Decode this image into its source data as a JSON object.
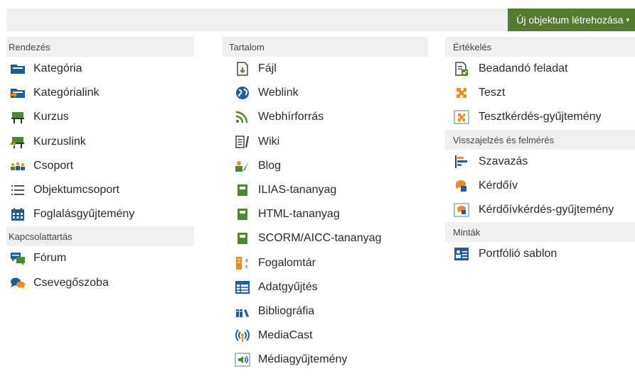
{
  "toolbar": {
    "create_label": "Új objektum létrehozása",
    "caret": "▾"
  },
  "columns": [
    {
      "groups": [
        {
          "title": "Rendezés",
          "items": [
            {
              "label": "Kategória",
              "icon": "category-folder-icon"
            },
            {
              "label": "Kategórialink",
              "icon": "category-link-icon"
            },
            {
              "label": "Kurzus",
              "icon": "course-icon"
            },
            {
              "label": "Kurzuslink",
              "icon": "course-link-icon"
            },
            {
              "label": "Csoport",
              "icon": "group-icon"
            },
            {
              "label": "Objektumcsoport",
              "icon": "object-group-list-icon"
            },
            {
              "label": "Foglalásgyűjtemény",
              "icon": "booking-calendar-icon"
            }
          ]
        },
        {
          "title": "Kapcsolattartás",
          "items": [
            {
              "label": "Fórum",
              "icon": "forum-icon"
            },
            {
              "label": "Csevegőszoba",
              "icon": "chat-icon"
            }
          ]
        }
      ]
    },
    {
      "groups": [
        {
          "title": "Tartalom",
          "items": [
            {
              "label": "Fájl",
              "icon": "file-download-icon"
            },
            {
              "label": "Weblink",
              "icon": "weblink-globe-icon"
            },
            {
              "label": "Webhírforrás",
              "icon": "rss-feed-icon"
            },
            {
              "label": "Wiki",
              "icon": "wiki-icon"
            },
            {
              "label": "Blog",
              "icon": "blog-icon"
            },
            {
              "label": "ILIAS-tananyag",
              "icon": "learning-module-icon"
            },
            {
              "label": "HTML-tananyag",
              "icon": "html-module-icon"
            },
            {
              "label": "SCORM/AICC-tananyag",
              "icon": "scorm-module-icon"
            },
            {
              "label": "Fogalomtár",
              "icon": "glossary-icon"
            },
            {
              "label": "Adatgyűjtés",
              "icon": "data-collection-table-icon"
            },
            {
              "label": "Bibliográfia",
              "icon": "bibliography-books-icon"
            },
            {
              "label": "MediaCast",
              "icon": "mediacast-broadcast-icon"
            },
            {
              "label": "Médiagyűjtemény",
              "icon": "media-pool-speaker-icon"
            }
          ]
        }
      ]
    },
    {
      "groups": [
        {
          "title": "Értékelés",
          "items": [
            {
              "label": "Beadandó feladat",
              "icon": "exercise-document-icon"
            },
            {
              "label": "Teszt",
              "icon": "test-puzzle-icon"
            },
            {
              "label": "Tesztkérdés-gyűjtemény",
              "icon": "question-pool-test-icon"
            }
          ]
        },
        {
          "title": "Visszajelzés és felmérés",
          "items": [
            {
              "label": "Szavazás",
              "icon": "poll-bars-icon"
            },
            {
              "label": "Kérdőív",
              "icon": "survey-icon"
            },
            {
              "label": "Kérdőívkérdés-gyűjtemény",
              "icon": "question-pool-survey-icon"
            }
          ]
        },
        {
          "title": "Minták",
          "items": [
            {
              "label": "Portfólió sablon",
              "icon": "portfolio-template-icon"
            }
          ]
        }
      ]
    }
  ],
  "colors": {
    "create_button_bg": "#557b2e",
    "header_bg": "#f0f0f0",
    "icon_blue": "#1e5c9e",
    "icon_green": "#4a8a2b",
    "icon_orange": "#f08c1a"
  }
}
